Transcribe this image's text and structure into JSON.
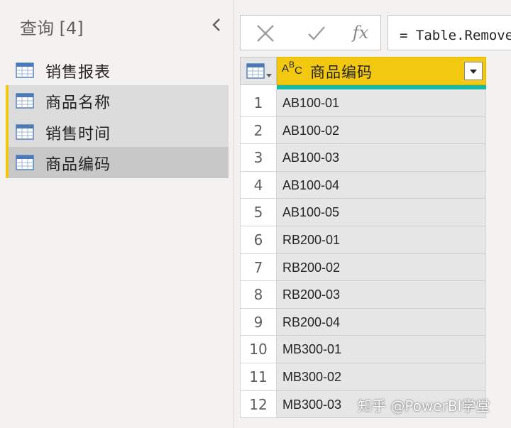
{
  "queries_pane": {
    "title": "查询 [4]",
    "items": [
      {
        "label": "销售报表",
        "selected": false
      },
      {
        "label": "商品名称",
        "selected": false
      },
      {
        "label": "销售时间",
        "selected": false
      },
      {
        "label": "商品编码",
        "selected": true
      }
    ]
  },
  "formula_bar": {
    "formula": "= Table.RemoveColumns(源,{\"商品名称\", \"销售时间\"})",
    "fx_label": "fx"
  },
  "grid": {
    "column_type": {
      "main": "A",
      "sup": "B",
      "sub": "C"
    },
    "column_header": "商品编码",
    "rows": [
      {
        "num": "1",
        "value": "AB100-01"
      },
      {
        "num": "2",
        "value": "AB100-02"
      },
      {
        "num": "3",
        "value": "AB100-03"
      },
      {
        "num": "4",
        "value": "AB100-04"
      },
      {
        "num": "5",
        "value": "AB100-05"
      },
      {
        "num": "6",
        "value": "RB200-01"
      },
      {
        "num": "7",
        "value": "RB200-02"
      },
      {
        "num": "8",
        "value": "RB200-03"
      },
      {
        "num": "9",
        "value": "RB200-04"
      },
      {
        "num": "10",
        "value": "MB300-01"
      },
      {
        "num": "11",
        "value": "MB300-02"
      },
      {
        "num": "12",
        "value": "MB300-03"
      }
    ]
  },
  "watermark": "知乎 @PowerBI学堂",
  "colors": {
    "accent": "#f2c811",
    "quality_strip": "#17b8a6",
    "table_icon": "#4a79b8"
  },
  "icons": [
    "table-icon",
    "collapse-chevron-icon",
    "cancel-x-icon",
    "commit-check-icon",
    "fx-icon",
    "text-type-icon",
    "dropdown-arrow-icon"
  ]
}
